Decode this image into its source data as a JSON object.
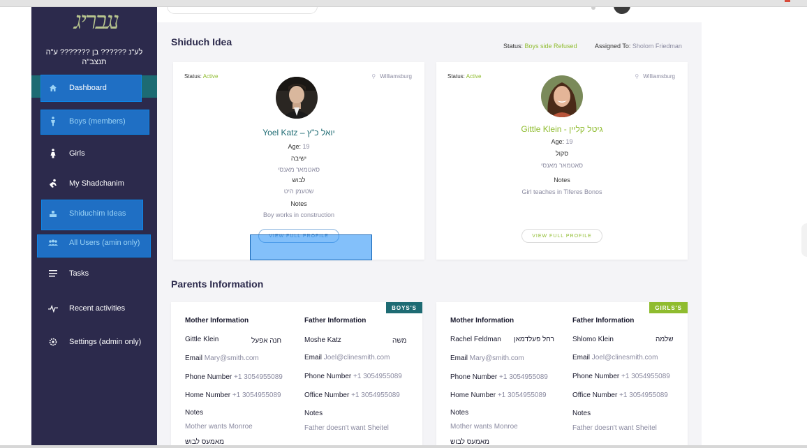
{
  "sidebar": {
    "logo_text": "נגבריג",
    "dedication": "לע\"נ ?????? בן ??????? ע\"ה תנצב\"ה",
    "items": [
      {
        "label": "Dashboard",
        "icon": "home-icon"
      },
      {
        "label": "Boys (members)",
        "icon": "boy-icon"
      },
      {
        "label": "Girls",
        "icon": "girl-icon"
      },
      {
        "label": "My Shadchanim",
        "icon": "handshake-icon"
      },
      {
        "label": "Shiduchim Ideas",
        "icon": "idea-icon"
      },
      {
        "label": "All Users (amin only)",
        "icon": "users-icon"
      },
      {
        "label": "Tasks",
        "icon": "list-icon"
      },
      {
        "label": "Recent activities",
        "icon": "activity-icon"
      },
      {
        "label": "Settings  (admin only)",
        "icon": "gear-icon"
      }
    ]
  },
  "idea": {
    "title": "Shiduch Idea",
    "status_label": "Status:",
    "status_value": "Boys side Refused",
    "assigned_label": "Assigned To:",
    "assigned_value": "Sholom Friedman"
  },
  "boy": {
    "status_label": "Status:",
    "status_value": "Active",
    "location": "Williamsburg",
    "name": "Yoel Katz – יואל כ\"ץ",
    "age_label": "Age:",
    "age": "19",
    "yeshiva_label": "ישיבה",
    "yeshiva": "סאטמאר מאנסי",
    "dress_label": "לבוש",
    "dress": "שטעמן היט",
    "notes_label": "Notes",
    "notes": "Boy works in construction",
    "button": "VIEW FULL PROFILE"
  },
  "girl": {
    "status_label": "Status:",
    "status_value": "Active",
    "location": "Williamsburg",
    "name": "Gittle Klein - גיטל קליין",
    "age_label": "Age:",
    "age": "19",
    "school_label": "סקול",
    "school": "סאטמאר מאנסי",
    "notes_label": "Notes",
    "notes": "Girl teaches in Tiferes Bonos",
    "button": "VIEW FULL PROFILE"
  },
  "parents": {
    "title": "Parents Information",
    "boys": {
      "tag": "BOYS'S",
      "mother_header": "Mother Information",
      "father_header": "Father Information",
      "mother_name": "Gittle Klein",
      "mother_name_heb": "חנה אפעל",
      "father_name": "Moshe Katz",
      "father_name_heb": "משה",
      "email_label": "Email",
      "mother_email": "Mary@smith.com",
      "father_email": "Joel@clinesmith.com",
      "phone_label": "Phone Number",
      "mother_phone": "+1 3054955089",
      "father_phone": "+1 3054955089",
      "home_label": "Home Number",
      "mother_home": "+1 3054955089",
      "office_label": "Office Number",
      "father_office": "+1 3054955089",
      "notes_label": "Notes",
      "mother_notes": "Mother wants Monroe",
      "father_notes": "Father doesn't want Sheitel",
      "bottom_heb": "מאמעס לבוש"
    },
    "girls": {
      "tag": "GIRLS'S",
      "mother_header": "Mother Information",
      "father_header": "Father Information",
      "mother_name": "Rachel Feldman",
      "mother_name_heb": "רחל פעלדמאן",
      "father_name": "Shlomo Klein",
      "father_name_heb": "שלמה",
      "email_label": "Email",
      "mother_email": "Mary@smith.com",
      "father_email": "Joel@clinesmith.com",
      "phone_label": "Phone Number",
      "mother_phone": "+1 3054955089",
      "father_phone": "+1 3054955089",
      "home_label": "Home Number",
      "mother_home": "+1 3054955089",
      "office_label": "Office Number",
      "father_office": "+1 3054955089",
      "notes_label": "Notes",
      "mother_notes": "Mother wants Monroe",
      "father_notes": "Father doesn't want Sheitel",
      "bottom_heb": "מאמעס לבוש"
    }
  },
  "colors": {
    "sidebar": "#2c2a4c",
    "accent_teal": "#1e6b73",
    "accent_green": "#8fbc2f",
    "highlight_blue": "#1f6fc4"
  }
}
